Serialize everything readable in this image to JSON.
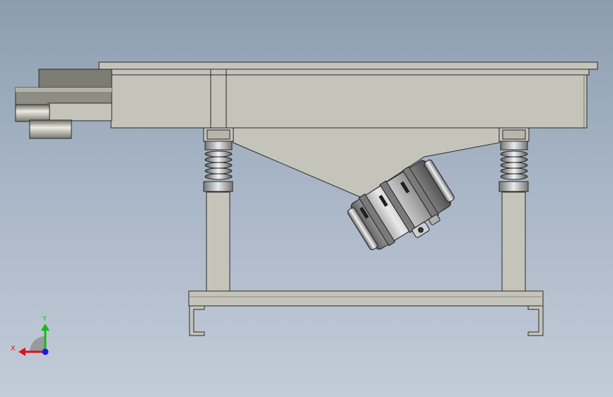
{
  "viewport": {
    "background_top": "#8d9db0",
    "background_bottom": "#c3ccd8"
  },
  "model": {
    "part_fill": "#c4c4bb",
    "part_edge": "#2a2a2a",
    "motor_fill": "#9a9a9a"
  },
  "triad": {
    "x_label": "X",
    "y_label": "Y",
    "x_color": "#e0101a",
    "y_color": "#18b818",
    "z_color": "#1818e0"
  }
}
